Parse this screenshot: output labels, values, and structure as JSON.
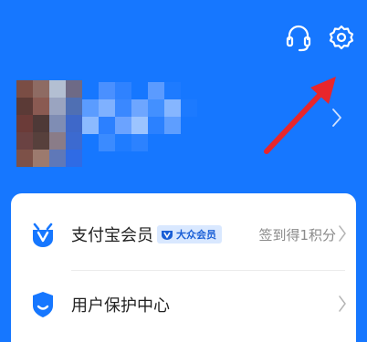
{
  "header": {
    "headset_icon": "headset-icon",
    "settings_icon": "gear-icon",
    "background_color": "#1677ff"
  },
  "profile": {
    "avatar": "pixelated-avatar",
    "name_redacted": "pixelated-name"
  },
  "annotation": {
    "arrow_color": "#e8262b"
  },
  "list": {
    "items": [
      {
        "title": "支付宝会员",
        "badge": "大众会员",
        "right_text": "签到得1积分",
        "icon": "member-icon"
      },
      {
        "title": "用户保护中心",
        "right_text": "",
        "icon": "shield-icon"
      }
    ]
  }
}
